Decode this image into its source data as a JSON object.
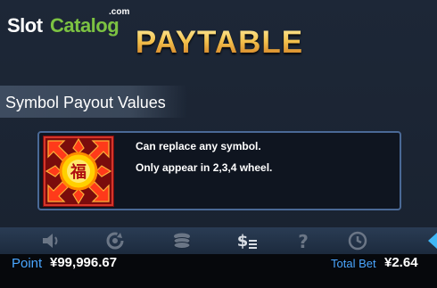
{
  "watermark": {
    "part1": "Slot",
    "part2": "Catalog",
    "suffix": ".com"
  },
  "header": {
    "title": "PAYTABLE"
  },
  "section": {
    "title": "Symbol Payout Values"
  },
  "wild_card": {
    "symbol_icon": "fu-wild-symbol",
    "symbol_glyph": "福",
    "line1": "Can replace any symbol.",
    "line2": "Only appear in 2,3,4 wheel."
  },
  "toolbar": {
    "icons": [
      "sound-icon",
      "autoplay-icon",
      "chips-icon",
      "paytable-icon",
      "help-icon",
      "history-icon",
      "back-arrow-icon"
    ],
    "active": "paytable-icon"
  },
  "footer": {
    "point_label": "Point",
    "point_value": "¥99,996.67",
    "total_bet_label": "Total Bet",
    "total_bet_value": "¥2.64"
  },
  "colors": {
    "accent_blue": "#4aa6ff",
    "title_gold": "#f4c24d",
    "icon_gray": "#6b7686",
    "active_icon": "#d8dde4"
  }
}
